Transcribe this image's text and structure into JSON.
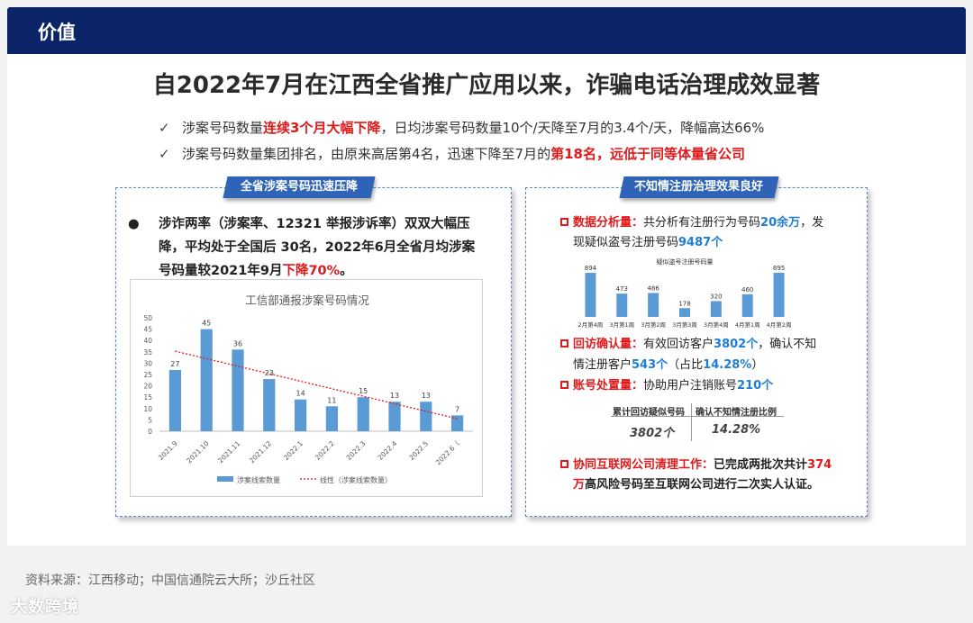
{
  "header": {
    "title": "价值"
  },
  "headline": "自2022年7月在江西全省推广应用以来，诈骗电话治理成效显著",
  "bullets": [
    {
      "check": "✓",
      "pre": "涉案号码数量",
      "red": "连续3个月大幅下降",
      "post": "，日均涉案号码数量10个/天降至7月的3.4个/天，降幅高达66%"
    },
    {
      "check": "✓",
      "pre": "涉案号码数量集团排名，由原来高居第4名，迅速下降至7月的",
      "red": "第18名，远低于同等体量省公司",
      "post": ""
    }
  ],
  "left_panel": {
    "tag": "全省涉案号码迅速压降",
    "bullet_mark": "●",
    "text_pre": "涉诈两率（涉案率、12321 举报涉诉率）双双大幅压降，平均处于全国后 30名，2022年6月全省月均涉案号码量较2021年9月",
    "text_red": "下降70%",
    "text_post": "。"
  },
  "right_panel": {
    "tag": "不知情注册治理效果良好",
    "analysis": {
      "label": "数据分析量：",
      "pre": "共分析有注册行为号码",
      "hl": "20余万",
      "mid": "，发",
      "line2_pre": "现疑似盗号注册号码",
      "line2_hl": "9487个"
    },
    "visit": {
      "label": "回访确认量：",
      "pre": "有效回访客户",
      "hl": "3802个",
      "mid": "，确认不知",
      "line2_pre": "情注册客户",
      "line2_hl": "543个",
      "line2_mid": "（占比",
      "line2_hl2": "14.28%",
      "line2_post": "）"
    },
    "account": {
      "label": "账号处置量：",
      "pre": "协助用户注销账号",
      "hl": "210个"
    },
    "kpi": [
      {
        "label": "累计回访疑似号码",
        "value": "3802个"
      },
      {
        "label": "确认不知情注册比例",
        "value": "14.28%"
      }
    ],
    "cleanup": {
      "label": "协同互联网公司清理工作：",
      "pre": "已完成两批次共计",
      "hl": "374",
      "line2_hl": "万",
      "line2_post": "高风险号码至互联网公司进行二次实人认证。"
    }
  },
  "source": "资料来源：江西移动；中国信通院云大所；沙丘社区",
  "watermark": "大数跨境",
  "colors": {
    "header_bg": "#0a2467",
    "bar": "#5b9bd5",
    "red": "#e0191b",
    "blue": "#1e7ed4",
    "tag_bg": "#2e63b8"
  },
  "chart_data": [
    {
      "type": "bar",
      "title": "工信部通报涉案号码情况",
      "categories": [
        "2021.9",
        "2021.10",
        "2021.11",
        "2021.12",
        "2022.1",
        "2022.2",
        "2022.3",
        "2022.4",
        "2022.5",
        "2022.6（"
      ],
      "series": [
        {
          "name": "涉案线索数量",
          "values": [
            27,
            45,
            36,
            23,
            14,
            11,
            15,
            13,
            13,
            7
          ]
        }
      ],
      "trendline": {
        "name": "线性（涉案线索数量）",
        "style": "dotted",
        "color": "#e0191b"
      },
      "yticks": [
        0,
        5,
        10,
        15,
        20,
        25,
        30,
        35,
        40,
        45,
        50
      ],
      "ylim": [
        0,
        50
      ],
      "grid": false,
      "legend": "bottom"
    },
    {
      "type": "bar",
      "title": "疑似盗号注册号码量",
      "categories": [
        "2月第4周",
        "3月第1周",
        "3月第2周",
        "3月第3周",
        "3月第4周",
        "4月第1周",
        "4月第2周"
      ],
      "series": [
        {
          "values": [
            894,
            473,
            486,
            178,
            320,
            460,
            895
          ]
        }
      ],
      "ylim": [
        0,
        950
      ],
      "grid": false
    }
  ]
}
